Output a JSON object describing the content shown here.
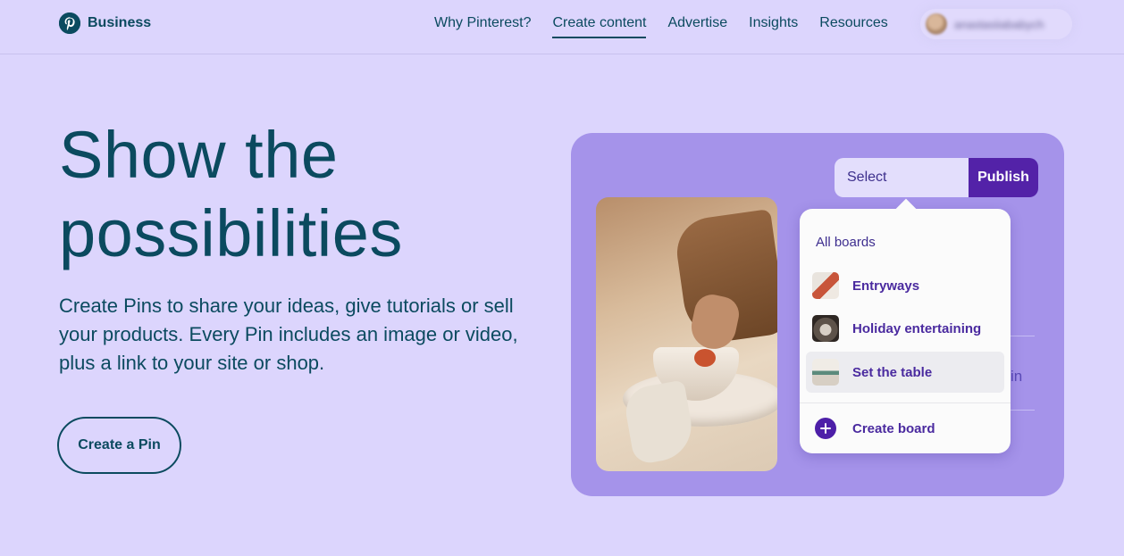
{
  "header": {
    "brand": "Business",
    "nav": [
      {
        "label": "Why Pinterest?"
      },
      {
        "label": "Create content"
      },
      {
        "label": "Advertise"
      },
      {
        "label": "Insights"
      },
      {
        "label": "Resources"
      }
    ],
    "active_nav": "Create content",
    "account_name": "anastasiiababych"
  },
  "hero": {
    "title_line1": "Show the",
    "title_line2": "possibilities",
    "description": "Create Pins to share your ideas, give tutorials or sell your products. Every Pin includes an image or video, plus a link to your site or shop.",
    "cta_label": "Create a Pin"
  },
  "showcase": {
    "select_label": "Select",
    "publish_label": "Publish",
    "background_text": "in",
    "dropdown": {
      "header": "All boards",
      "boards": [
        {
          "label": "Entryways",
          "thumb_icon": "entryway-thumbnail"
        },
        {
          "label": "Holiday entertaining",
          "thumb_icon": "holiday-thumbnail"
        },
        {
          "label": "Set the table",
          "thumb_icon": "table-thumbnail"
        }
      ],
      "highlighted_board": "Set the table",
      "create_label": "Create board"
    }
  },
  "colors": {
    "page_background": "#dcd5fd",
    "brand_teal": "#0b4a5f",
    "card_purple": "#a593ea",
    "publish_purple": "#5322a8",
    "board_label_purple": "#4a2a9f"
  }
}
